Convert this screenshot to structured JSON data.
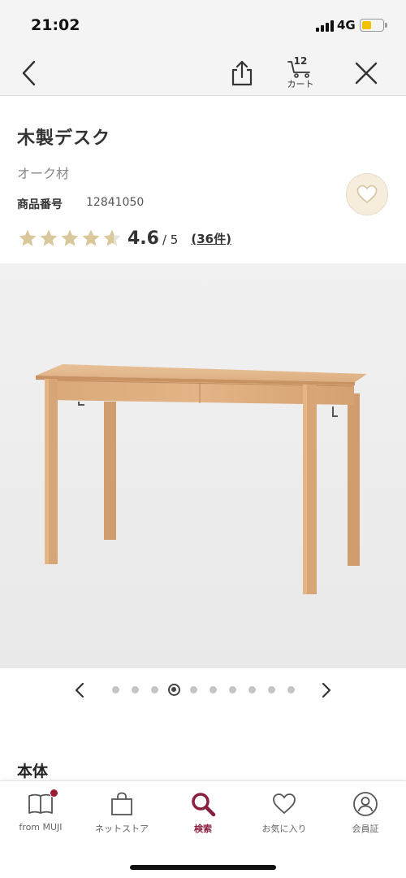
{
  "status_bar": {
    "time": "21:02",
    "network": "4G",
    "battery_color": "#f2c200"
  },
  "nav": {
    "cart_count": "12",
    "cart_label": "カート"
  },
  "product": {
    "title": "木製デスク",
    "variant": "オーク材",
    "number_label": "商品番号",
    "number": "12841050",
    "rating": {
      "stars": 4.6,
      "value": "4.6",
      "max": "/ 5",
      "count": "(36件)"
    }
  },
  "carousel": {
    "total": 10,
    "current": 4
  },
  "section": {
    "heading": "本体"
  },
  "tabs": [
    {
      "label": "from MUJI",
      "icon": "book-icon",
      "active": false
    },
    {
      "label": "ネットストア",
      "icon": "shopping-bag-icon",
      "active": false
    },
    {
      "label": "検索",
      "icon": "search-icon",
      "active": true
    },
    {
      "label": "お気に入り",
      "icon": "heart-icon",
      "active": false
    },
    {
      "label": "会員証",
      "icon": "member-card-icon",
      "active": false
    }
  ],
  "colors": {
    "accent": "#8b1e3f",
    "star": "#d9c89c",
    "favorite_bg": "#f6eddc",
    "notification": "#9b1b30"
  }
}
